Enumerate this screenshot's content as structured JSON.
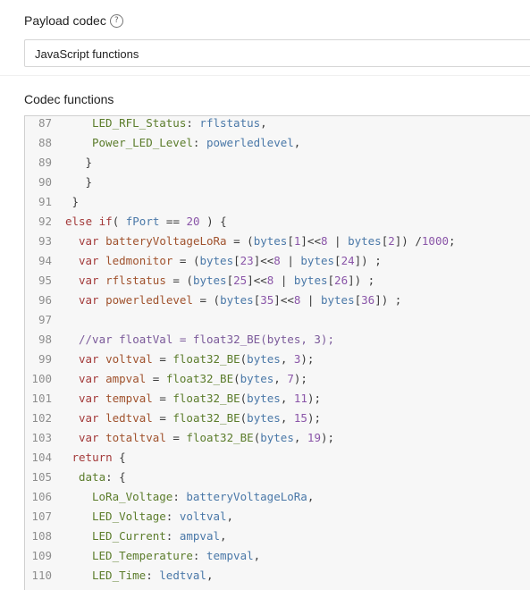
{
  "payload_codec": {
    "label": "Payload codec",
    "help_icon": "?",
    "selected": "JavaScript functions"
  },
  "codec_functions": {
    "label": "Codec functions",
    "lines": [
      {
        "n": "87",
        "indent": 4,
        "tokens": [
          [
            "prop",
            "LED_RFL_Status"
          ],
          [
            "op",
            ": "
          ],
          [
            "id",
            "rflstatus"
          ],
          [
            "op",
            ","
          ]
        ]
      },
      {
        "n": "88",
        "indent": 4,
        "tokens": [
          [
            "prop",
            "Power_LED_Level"
          ],
          [
            "op",
            ": "
          ],
          [
            "id",
            "powerledlevel"
          ],
          [
            "op",
            ","
          ]
        ]
      },
      {
        "n": "89",
        "indent": 3,
        "tokens": [
          [
            "op",
            "}"
          ]
        ]
      },
      {
        "n": "90",
        "indent": 3,
        "tokens": [
          [
            "op",
            "}"
          ]
        ]
      },
      {
        "n": "91",
        "indent": 1,
        "tokens": [
          [
            "op",
            "}"
          ]
        ]
      },
      {
        "n": "92",
        "indent": 0,
        "tokens": [
          [
            "kw",
            "else if"
          ],
          [
            "op",
            "( "
          ],
          [
            "id",
            "fPort"
          ],
          [
            "op",
            " == "
          ],
          [
            "num",
            "20"
          ],
          [
            "op",
            " ) {"
          ]
        ]
      },
      {
        "n": "93",
        "indent": 2,
        "tokens": [
          [
            "kw",
            "var "
          ],
          [
            "var",
            "batteryVoltageLoRa"
          ],
          [
            "op",
            " = ("
          ],
          [
            "id",
            "bytes"
          ],
          [
            "op",
            "["
          ],
          [
            "num",
            "1"
          ],
          [
            "op",
            "]<<"
          ],
          [
            "num",
            "8"
          ],
          [
            "op",
            " | "
          ],
          [
            "id",
            "bytes"
          ],
          [
            "op",
            "["
          ],
          [
            "num",
            "2"
          ],
          [
            "op",
            "]) /"
          ],
          [
            "num",
            "1000"
          ],
          [
            "op",
            ";"
          ]
        ]
      },
      {
        "n": "94",
        "indent": 2,
        "tokens": [
          [
            "kw",
            "var "
          ],
          [
            "var",
            "ledmonitor"
          ],
          [
            "op",
            " = ("
          ],
          [
            "id",
            "bytes"
          ],
          [
            "op",
            "["
          ],
          [
            "num",
            "23"
          ],
          [
            "op",
            "]<<"
          ],
          [
            "num",
            "8"
          ],
          [
            "op",
            " | "
          ],
          [
            "id",
            "bytes"
          ],
          [
            "op",
            "["
          ],
          [
            "num",
            "24"
          ],
          [
            "op",
            "]) ;"
          ]
        ]
      },
      {
        "n": "95",
        "indent": 2,
        "tokens": [
          [
            "kw",
            "var "
          ],
          [
            "var",
            "rflstatus"
          ],
          [
            "op",
            " = ("
          ],
          [
            "id",
            "bytes"
          ],
          [
            "op",
            "["
          ],
          [
            "num",
            "25"
          ],
          [
            "op",
            "]<<"
          ],
          [
            "num",
            "8"
          ],
          [
            "op",
            " | "
          ],
          [
            "id",
            "bytes"
          ],
          [
            "op",
            "["
          ],
          [
            "num",
            "26"
          ],
          [
            "op",
            "]) ;"
          ]
        ]
      },
      {
        "n": "96",
        "indent": 2,
        "tokens": [
          [
            "kw",
            "var "
          ],
          [
            "var",
            "powerledlevel"
          ],
          [
            "op",
            " = ("
          ],
          [
            "id",
            "bytes"
          ],
          [
            "op",
            "["
          ],
          [
            "num",
            "35"
          ],
          [
            "op",
            "]<<"
          ],
          [
            "num",
            "8"
          ],
          [
            "op",
            " | "
          ],
          [
            "id",
            "bytes"
          ],
          [
            "op",
            "["
          ],
          [
            "num",
            "36"
          ],
          [
            "op",
            "]) ;"
          ]
        ]
      },
      {
        "n": "97",
        "indent": 0,
        "tokens": []
      },
      {
        "n": "98",
        "indent": 2,
        "tokens": [
          [
            "com",
            "//var floatVal = float32_BE(bytes, 3);"
          ]
        ]
      },
      {
        "n": "99",
        "indent": 2,
        "tokens": [
          [
            "kw",
            "var "
          ],
          [
            "var",
            "voltval"
          ],
          [
            "op",
            " = "
          ],
          [
            "prop",
            "float32_BE"
          ],
          [
            "op",
            "("
          ],
          [
            "id",
            "bytes"
          ],
          [
            "op",
            ", "
          ],
          [
            "num",
            "3"
          ],
          [
            "op",
            ");"
          ]
        ]
      },
      {
        "n": "100",
        "indent": 2,
        "tokens": [
          [
            "kw",
            "var "
          ],
          [
            "var",
            "ampval"
          ],
          [
            "op",
            " = "
          ],
          [
            "prop",
            "float32_BE"
          ],
          [
            "op",
            "("
          ],
          [
            "id",
            "bytes"
          ],
          [
            "op",
            ", "
          ],
          [
            "num",
            "7"
          ],
          [
            "op",
            ");"
          ]
        ]
      },
      {
        "n": "101",
        "indent": 2,
        "tokens": [
          [
            "kw",
            "var "
          ],
          [
            "var",
            "tempval"
          ],
          [
            "op",
            " = "
          ],
          [
            "prop",
            "float32_BE"
          ],
          [
            "op",
            "("
          ],
          [
            "id",
            "bytes"
          ],
          [
            "op",
            ", "
          ],
          [
            "num",
            "11"
          ],
          [
            "op",
            ");"
          ]
        ]
      },
      {
        "n": "102",
        "indent": 2,
        "tokens": [
          [
            "kw",
            "var "
          ],
          [
            "var",
            "ledtval"
          ],
          [
            "op",
            " = "
          ],
          [
            "prop",
            "float32_BE"
          ],
          [
            "op",
            "("
          ],
          [
            "id",
            "bytes"
          ],
          [
            "op",
            ", "
          ],
          [
            "num",
            "15"
          ],
          [
            "op",
            ");"
          ]
        ]
      },
      {
        "n": "103",
        "indent": 2,
        "tokens": [
          [
            "kw",
            "var "
          ],
          [
            "var",
            "totaltval"
          ],
          [
            "op",
            " = "
          ],
          [
            "prop",
            "float32_BE"
          ],
          [
            "op",
            "("
          ],
          [
            "id",
            "bytes"
          ],
          [
            "op",
            ", "
          ],
          [
            "num",
            "19"
          ],
          [
            "op",
            ");"
          ]
        ]
      },
      {
        "n": "104",
        "indent": 1,
        "tokens": [
          [
            "kw",
            "return"
          ],
          [
            "op",
            " {"
          ]
        ]
      },
      {
        "n": "105",
        "indent": 2,
        "tokens": [
          [
            "prop",
            "data"
          ],
          [
            "op",
            ": {"
          ]
        ]
      },
      {
        "n": "106",
        "indent": 4,
        "tokens": [
          [
            "prop",
            "LoRa_Voltage"
          ],
          [
            "op",
            ": "
          ],
          [
            "id",
            "batteryVoltageLoRa"
          ],
          [
            "op",
            ","
          ]
        ]
      },
      {
        "n": "107",
        "indent": 4,
        "tokens": [
          [
            "prop",
            "LED_Voltage"
          ],
          [
            "op",
            ": "
          ],
          [
            "id",
            "voltval"
          ],
          [
            "op",
            ","
          ]
        ]
      },
      {
        "n": "108",
        "indent": 4,
        "tokens": [
          [
            "prop",
            "LED_Current"
          ],
          [
            "op",
            ": "
          ],
          [
            "id",
            "ampval"
          ],
          [
            "op",
            ","
          ]
        ]
      },
      {
        "n": "109",
        "indent": 4,
        "tokens": [
          [
            "prop",
            "LED_Temperature"
          ],
          [
            "op",
            ": "
          ],
          [
            "id",
            "tempval"
          ],
          [
            "op",
            ","
          ]
        ]
      },
      {
        "n": "110",
        "indent": 4,
        "tokens": [
          [
            "prop",
            "LED_Time"
          ],
          [
            "op",
            ": "
          ],
          [
            "id",
            "ledtval"
          ],
          [
            "op",
            ","
          ]
        ]
      }
    ]
  }
}
